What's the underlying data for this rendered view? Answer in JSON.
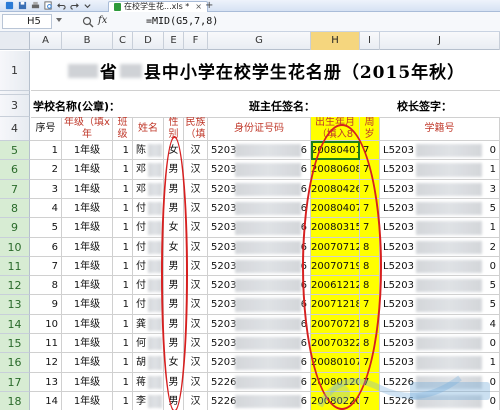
{
  "window": {
    "tab_title": "在校学生花...xls *",
    "tab_close": "×",
    "tab_add": "+"
  },
  "formula_bar": {
    "name_box": "H5",
    "fx_label": "fx",
    "formula": "=MID(G5,7,8)"
  },
  "columns": [
    "A",
    "B",
    "C",
    "D",
    "E",
    "F",
    "G",
    "H",
    "I",
    "J"
  ],
  "selected_column": "H",
  "sheet": {
    "title_prefix": "省",
    "title_middle": "县中小学在校学生花名册（2015年秋）",
    "school_label": "学校名称(公章)：",
    "teacher_label": "班主任签名：",
    "principal_label": "校长签字：",
    "headers": {
      "seq": "序号",
      "grade": "年级（填x年",
      "class": "班级",
      "name": "姓名",
      "gender": "性别",
      "ethnicity": "民族（填",
      "id_number": "身份证号码",
      "birth": "出生年月（填入8",
      "age": "周岁",
      "student_no": "学籍号"
    },
    "rows": [
      {
        "row": "5",
        "seq": "1",
        "grade": "1年级",
        "class": "1",
        "name": "陈",
        "gender": "女",
        "ethnicity": "汉",
        "id_prefix": "5203",
        "id_suffix": "6",
        "birth": "20080401",
        "age": "7",
        "student_no": "L5203",
        "no_suffix": "0"
      },
      {
        "row": "6",
        "seq": "2",
        "grade": "1年级",
        "class": "1",
        "name": "邓",
        "gender": "男",
        "ethnicity": "汉",
        "id_prefix": "5203",
        "id_suffix": "6",
        "birth": "20080608",
        "age": "7",
        "student_no": "L5203",
        "no_suffix": "1"
      },
      {
        "row": "7",
        "seq": "3",
        "grade": "1年级",
        "class": "1",
        "name": "邓",
        "gender": "男",
        "ethnicity": "汉",
        "id_prefix": "5203",
        "id_suffix": "6",
        "birth": "20080426",
        "age": "7",
        "student_no": "L5203",
        "no_suffix": "3"
      },
      {
        "row": "8",
        "seq": "4",
        "grade": "1年级",
        "class": "1",
        "name": "付",
        "gender": "男",
        "ethnicity": "汉",
        "id_prefix": "5203",
        "id_suffix": "6",
        "birth": "20080407",
        "age": "7",
        "student_no": "L5203",
        "no_suffix": "5"
      },
      {
        "row": "9",
        "seq": "5",
        "grade": "1年级",
        "class": "1",
        "name": "付",
        "gender": "女",
        "ethnicity": "汉",
        "id_prefix": "5203",
        "id_suffix": "6",
        "birth": "20080315",
        "age": "7",
        "student_no": "L5203",
        "no_suffix": "1"
      },
      {
        "row": "10",
        "seq": "6",
        "grade": "1年级",
        "class": "1",
        "name": "付",
        "gender": "女",
        "ethnicity": "汉",
        "id_prefix": "5203",
        "id_suffix": "6",
        "birth": "20070712",
        "age": "8",
        "student_no": "L5203",
        "no_suffix": "2"
      },
      {
        "row": "11",
        "seq": "7",
        "grade": "1年级",
        "class": "1",
        "name": "付",
        "gender": "男",
        "ethnicity": "汉",
        "id_prefix": "5203",
        "id_suffix": "6",
        "birth": "20070719",
        "age": "8",
        "student_no": "L5203",
        "no_suffix": "0"
      },
      {
        "row": "12",
        "seq": "8",
        "grade": "1年级",
        "class": "1",
        "name": "付",
        "gender": "男",
        "ethnicity": "汉",
        "id_prefix": "5203",
        "id_suffix": "6",
        "birth": "20061212",
        "age": "8",
        "student_no": "L5203",
        "no_suffix": "5"
      },
      {
        "row": "13",
        "seq": "9",
        "grade": "1年级",
        "class": "1",
        "name": "付",
        "gender": "男",
        "ethnicity": "汉",
        "id_prefix": "5203",
        "id_suffix": "6",
        "birth": "20071218",
        "age": "7",
        "student_no": "L5203",
        "no_suffix": "5"
      },
      {
        "row": "14",
        "seq": "10",
        "grade": "1年级",
        "class": "1",
        "name": "龚",
        "gender": "男",
        "ethnicity": "汉",
        "id_prefix": "5203",
        "id_suffix": "6",
        "birth": "20070721",
        "age": "8",
        "student_no": "L5203",
        "no_suffix": "4"
      },
      {
        "row": "15",
        "seq": "11",
        "grade": "1年级",
        "class": "1",
        "name": "何",
        "gender": "男",
        "ethnicity": "汉",
        "id_prefix": "5203",
        "id_suffix": "6",
        "birth": "20070322",
        "age": "8",
        "student_no": "L5203",
        "no_suffix": "0"
      },
      {
        "row": "16",
        "seq": "12",
        "grade": "1年级",
        "class": "1",
        "name": "胡",
        "gender": "女",
        "ethnicity": "汉",
        "id_prefix": "5203",
        "id_suffix": "6",
        "birth": "20080107",
        "age": "7",
        "student_no": "L5203",
        "no_suffix": "1"
      },
      {
        "row": "17",
        "seq": "13",
        "grade": "1年级",
        "class": "1",
        "name": "蒋",
        "gender": "男",
        "ethnicity": "汉",
        "id_prefix": "5226",
        "id_suffix": "6",
        "birth": "20080120",
        "age": "7",
        "student_no": "L5226",
        "no_suffix": "0"
      },
      {
        "row": "18",
        "seq": "14",
        "grade": "1年级",
        "class": "1",
        "name": "李",
        "gender": "男",
        "ethnicity": "汉",
        "id_prefix": "5226",
        "id_suffix": "6",
        "birth": "20080220",
        "age": "7",
        "student_no": "L5226",
        "no_suffix": "0"
      }
    ]
  },
  "colors": {
    "highlight_yellow": "#ffff00",
    "annotation_red": "#d62020",
    "header_red": "#c0392b",
    "selected_row_green": "#d7ecd3"
  },
  "watermark_icon": "site-logo-watermark"
}
